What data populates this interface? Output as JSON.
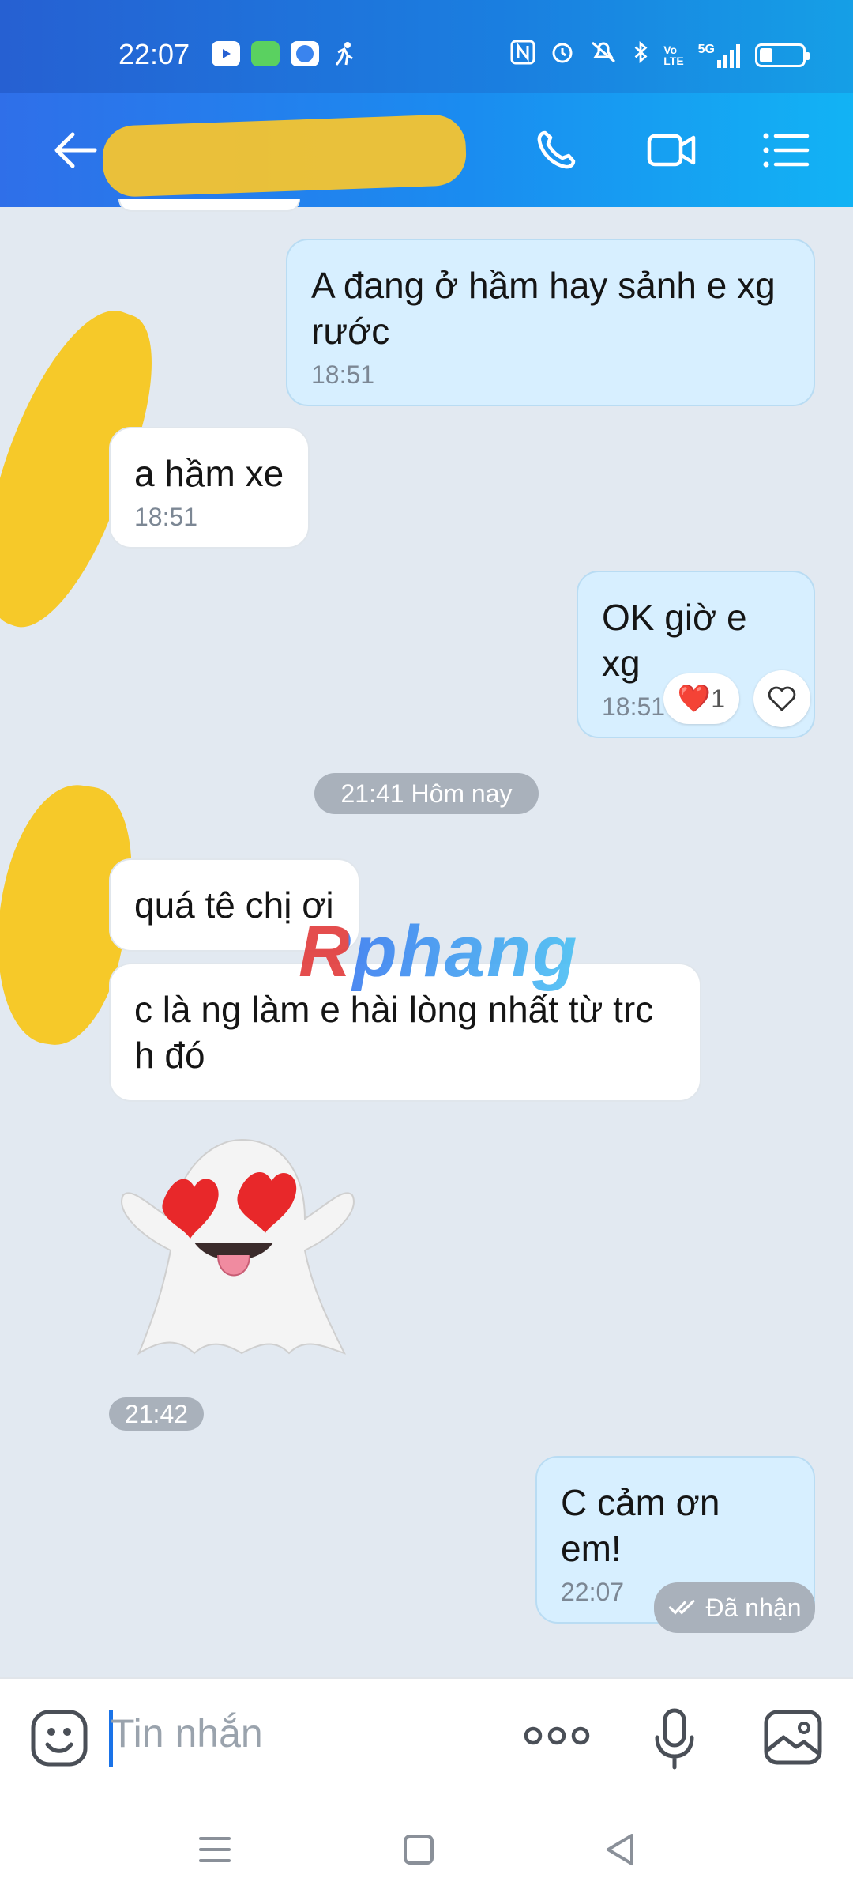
{
  "status": {
    "time": "22:07",
    "icons": [
      "youtube-icon",
      "messages-icon",
      "browser-icon",
      "runner-icon",
      "nfc-icon",
      "alarm-icon",
      "mute-icon",
      "bluetooth-icon",
      "volte-icon",
      "5g-signal-icon",
      "battery-icon"
    ],
    "network_label": "5G"
  },
  "header": {
    "icons": [
      "back-arrow-icon",
      "phone-icon",
      "video-camera-icon",
      "list-menu-icon"
    ]
  },
  "messages": [
    {
      "side": "out",
      "text": "A đang ở hầm hay sảnh e xg rước",
      "time": "18:51"
    },
    {
      "side": "in",
      "text": "a hầm xe",
      "time": "18:51"
    },
    {
      "side": "out",
      "text": "OK giờ e xg",
      "time": "18:51",
      "reaction": {
        "emoji": "❤️",
        "count": "1"
      }
    },
    {
      "side": "divider",
      "text": "21:41 Hôm nay"
    },
    {
      "side": "in",
      "text": "quá tê chị ơi"
    },
    {
      "side": "in",
      "text": "c là ng làm e hài lòng nhất từ trc h đó"
    },
    {
      "side": "in",
      "sticker": "ghost-heart-eyes",
      "time": "21:42"
    },
    {
      "side": "out",
      "text": "C cảm ơn em!",
      "time": "22:07",
      "status": "Đã nhận"
    }
  ],
  "watermark": "Rphang",
  "input": {
    "placeholder": "Tin nhắn",
    "icons": [
      "emoji-icon",
      "more-dots-icon",
      "microphone-icon",
      "image-icon"
    ]
  },
  "navbar": {
    "icons": [
      "menu-nav-icon",
      "home-nav-icon",
      "back-nav-icon"
    ]
  },
  "colors": {
    "header_start": "#2f6fe9",
    "header_end": "#12b3f4",
    "chat_bg": "#e2e9f1",
    "out_bubble": "#d7efff",
    "in_bubble": "#ffffff",
    "pill_bg": "#a9b1bb"
  }
}
